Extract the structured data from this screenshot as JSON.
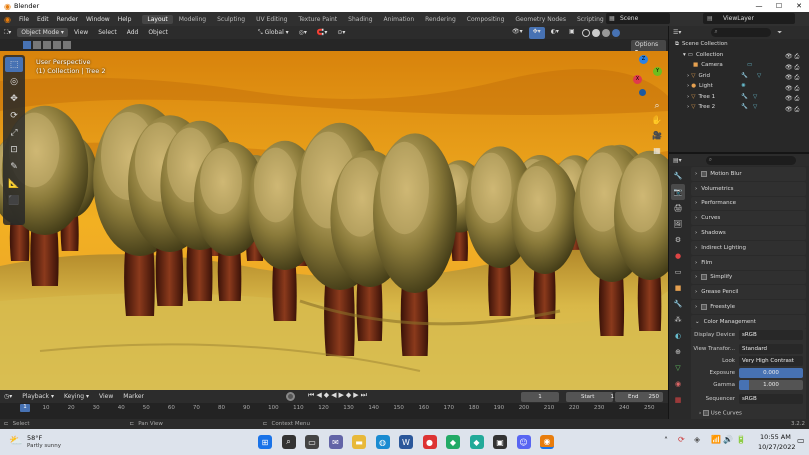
{
  "window": {
    "title": "Blender",
    "min": "—",
    "max": "☐",
    "close": "✕"
  },
  "menubar": {
    "menus": [
      "File",
      "Edit",
      "Render",
      "Window",
      "Help"
    ],
    "workspaces": [
      "Layout",
      "Modeling",
      "Sculpting",
      "UV Editing",
      "Texture Paint",
      "Shading",
      "Animation",
      "Rendering",
      "Compositing",
      "Geometry Nodes",
      "Scripting"
    ],
    "active_workspace": "Layout",
    "scene": "Scene",
    "view_layer": "ViewLayer"
  },
  "viewport_header": {
    "mode": "Object Mode",
    "menus": [
      "View",
      "Select",
      "Add",
      "Object"
    ],
    "transform": "Global",
    "options": "Options"
  },
  "viewport": {
    "overlay_title": "User Perspective",
    "overlay_sub": "(1) Collection | Tree 2",
    "gizmo": {
      "x": "X",
      "y": "Y",
      "z": "Z"
    }
  },
  "tools": [
    "select-box",
    "cursor",
    "move",
    "rotate",
    "scale",
    "transform",
    "annotate",
    "measure",
    "add-cube"
  ],
  "outliner": {
    "root": "Scene Collection",
    "collection": "Collection",
    "items": [
      "Camera",
      "Grid",
      "Light",
      "Tree 1",
      "Tree 2"
    ]
  },
  "properties": {
    "panels": [
      "Motion Blur",
      "Volumetrics",
      "Performance",
      "Curves",
      "Shadows",
      "Indirect Lighting",
      "Film",
      "Simplify",
      "Grease Pencil",
      "Freestyle",
      "Color Management"
    ],
    "checkbox_panels": [
      "Motion Blur",
      "Simplify",
      "Freestyle"
    ],
    "color_management": {
      "display_device_label": "Display Device",
      "display_device": "sRGB",
      "view_transform_label": "View Transfor...",
      "view_transform": "Standard",
      "look_label": "Look",
      "look": "Very High Contrast",
      "exposure_label": "Exposure",
      "exposure": "0.000",
      "gamma_label": "Gamma",
      "gamma": "1.000",
      "sequencer_label": "Sequencer",
      "sequencer": "sRGB",
      "use_curves": "Use Curves"
    }
  },
  "timeline": {
    "menus": [
      "Playback",
      "Keying",
      "View",
      "Marker"
    ],
    "current_frame": "1",
    "start_label": "Start",
    "start": "1",
    "end_label": "End",
    "end": "250",
    "ticks": [
      "1",
      "10",
      "20",
      "30",
      "40",
      "50",
      "60",
      "70",
      "80",
      "90",
      "100",
      "110",
      "120",
      "130",
      "140",
      "150",
      "160",
      "170",
      "180",
      "190",
      "200",
      "210",
      "220",
      "230",
      "240",
      "250"
    ]
  },
  "statusbar": {
    "select": "Select",
    "pan": "Pan View",
    "context": "Context Menu",
    "version": "3.2.2"
  },
  "taskbar": {
    "weather_temp": "58°F",
    "weather_desc": "Partly sunny",
    "time": "10:55 AM",
    "date": "10/27/2022",
    "icons": [
      "windows-start",
      "search",
      "task-view",
      "chat",
      "file-explorer",
      "edge",
      "word",
      "app-red",
      "app-green",
      "app-teal",
      "app-dark",
      "discord",
      "blender"
    ]
  },
  "colors": {
    "accent": "#4772b3",
    "sky_orange": "#e69b18",
    "grass": "#c9a53a"
  }
}
